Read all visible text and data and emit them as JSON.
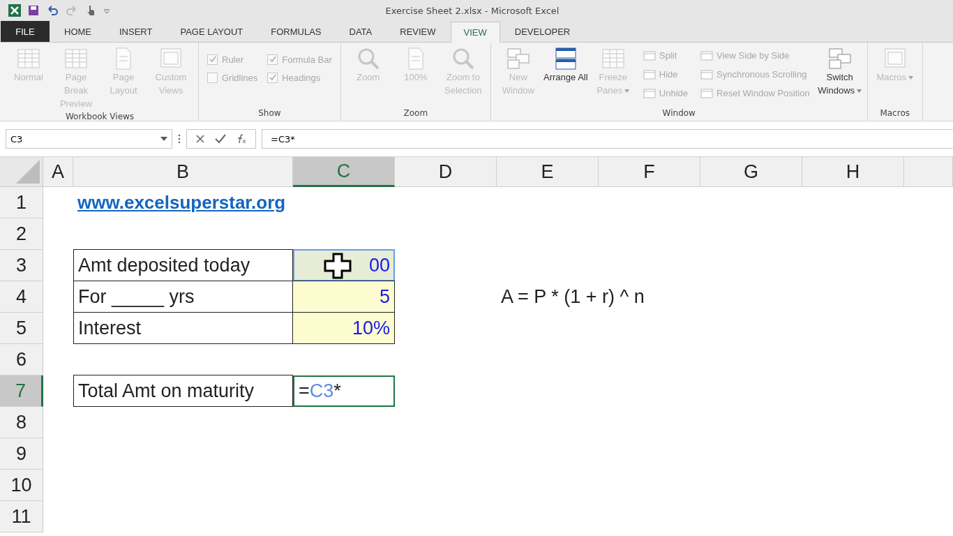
{
  "window": {
    "title": "Exercise Sheet 2.xlsx - Microsoft Excel"
  },
  "tabs": [
    {
      "label": "FILE",
      "kind": "file",
      "selected": false
    },
    {
      "label": "HOME",
      "kind": "tab",
      "selected": false
    },
    {
      "label": "INSERT",
      "kind": "tab",
      "selected": false
    },
    {
      "label": "PAGE LAYOUT",
      "kind": "tab",
      "selected": false
    },
    {
      "label": "FORMULAS",
      "kind": "tab",
      "selected": false
    },
    {
      "label": "DATA",
      "kind": "tab",
      "selected": false
    },
    {
      "label": "REVIEW",
      "kind": "tab",
      "selected": false
    },
    {
      "label": "VIEW",
      "kind": "tab",
      "selected": true
    },
    {
      "label": "DEVELOPER",
      "kind": "tab",
      "selected": false
    }
  ],
  "ribbon_groups": [
    {
      "label": "Workbook Views",
      "items": [
        {
          "kind": "large",
          "label": "Normal",
          "disabled": true
        },
        {
          "kind": "large",
          "label": "Page Break Preview",
          "disabled": true
        },
        {
          "kind": "large",
          "label": "Page Layout",
          "disabled": true
        },
        {
          "kind": "large",
          "label": "Custom Views",
          "disabled": true
        }
      ]
    },
    {
      "label": "Show",
      "items": [
        {
          "kind": "checks",
          "checks": [
            {
              "label": "Ruler",
              "checked": true,
              "disabled": true
            },
            {
              "label": "Gridlines",
              "checked": false,
              "disabled": true
            }
          ]
        },
        {
          "kind": "checks",
          "checks": [
            {
              "label": "Formula Bar",
              "checked": true,
              "disabled": true
            },
            {
              "label": "Headings",
              "checked": true,
              "disabled": true
            }
          ]
        }
      ]
    },
    {
      "label": "Zoom",
      "items": [
        {
          "kind": "large",
          "label": "Zoom",
          "disabled": true
        },
        {
          "kind": "large",
          "label": "100%",
          "disabled": true
        },
        {
          "kind": "large",
          "label": "Zoom to Selection",
          "disabled": true
        }
      ]
    },
    {
      "label": "Window",
      "items": [
        {
          "kind": "large",
          "label": "New Window",
          "disabled": true
        },
        {
          "kind": "large",
          "label": "Arrange All",
          "disabled": false
        },
        {
          "kind": "large",
          "label": "Freeze Panes",
          "disabled": true,
          "dropdown": true
        },
        {
          "kind": "small",
          "items": [
            {
              "label": "Split",
              "disabled": true
            },
            {
              "label": "Hide",
              "disabled": true
            },
            {
              "label": "Unhide",
              "disabled": true
            }
          ]
        },
        {
          "kind": "small",
          "items": [
            {
              "label": "View Side by Side",
              "disabled": true
            },
            {
              "label": "Synchronous Scrolling",
              "disabled": true
            },
            {
              "label": "Reset Window Position",
              "disabled": true
            }
          ]
        },
        {
          "kind": "large",
          "label": "Switch Windows",
          "disabled": false,
          "dropdown": true
        }
      ]
    },
    {
      "label": "Macros",
      "items": [
        {
          "kind": "large",
          "label": "Macros",
          "disabled": true,
          "dropdown": true
        }
      ]
    }
  ],
  "formula_bar": {
    "name_box": "C3",
    "formula": "=C3*"
  },
  "columns": [
    {
      "label": "A",
      "selected": false
    },
    {
      "label": "B",
      "selected": false
    },
    {
      "label": "C",
      "selected": true
    },
    {
      "label": "D",
      "selected": false
    },
    {
      "label": "E",
      "selected": false
    },
    {
      "label": "F",
      "selected": false
    },
    {
      "label": "G",
      "selected": false
    },
    {
      "label": "H",
      "selected": false
    }
  ],
  "rows": [
    {
      "label": "1",
      "selected": false,
      "cell_b": {
        "kind": "link",
        "text": "www.excelsuperstar.org"
      }
    },
    {
      "label": "2",
      "selected": false
    },
    {
      "label": "3",
      "selected": false,
      "cell_b": {
        "kind": "label",
        "text": "Amt deposited today"
      },
      "cell_c": {
        "kind": "input",
        "text": "00",
        "copied": true
      }
    },
    {
      "label": "4",
      "selected": false,
      "cell_b": {
        "kind": "label",
        "text": "For _____ yrs"
      },
      "cell_c": {
        "kind": "input",
        "text": "5"
      },
      "cell_e": {
        "kind": "note",
        "text": "A = P * (1 + r) ^ n"
      }
    },
    {
      "label": "5",
      "selected": false,
      "cell_b": {
        "kind": "label",
        "text": "Interest"
      },
      "cell_c": {
        "kind": "input",
        "text": "10%"
      }
    },
    {
      "label": "6",
      "selected": false
    },
    {
      "label": "7",
      "selected": true,
      "cell_b": {
        "kind": "label",
        "text": "Total Amt on maturity"
      },
      "cell_c": {
        "kind": "editing",
        "parts": [
          {
            "kind": "plain",
            "text": "="
          },
          {
            "kind": "ref",
            "text": "C3"
          },
          {
            "kind": "plain",
            "text": "*"
          }
        ]
      }
    },
    {
      "label": "8",
      "selected": false
    },
    {
      "label": "9",
      "selected": false
    },
    {
      "label": "10",
      "selected": false
    },
    {
      "label": "11",
      "selected": false
    }
  ]
}
